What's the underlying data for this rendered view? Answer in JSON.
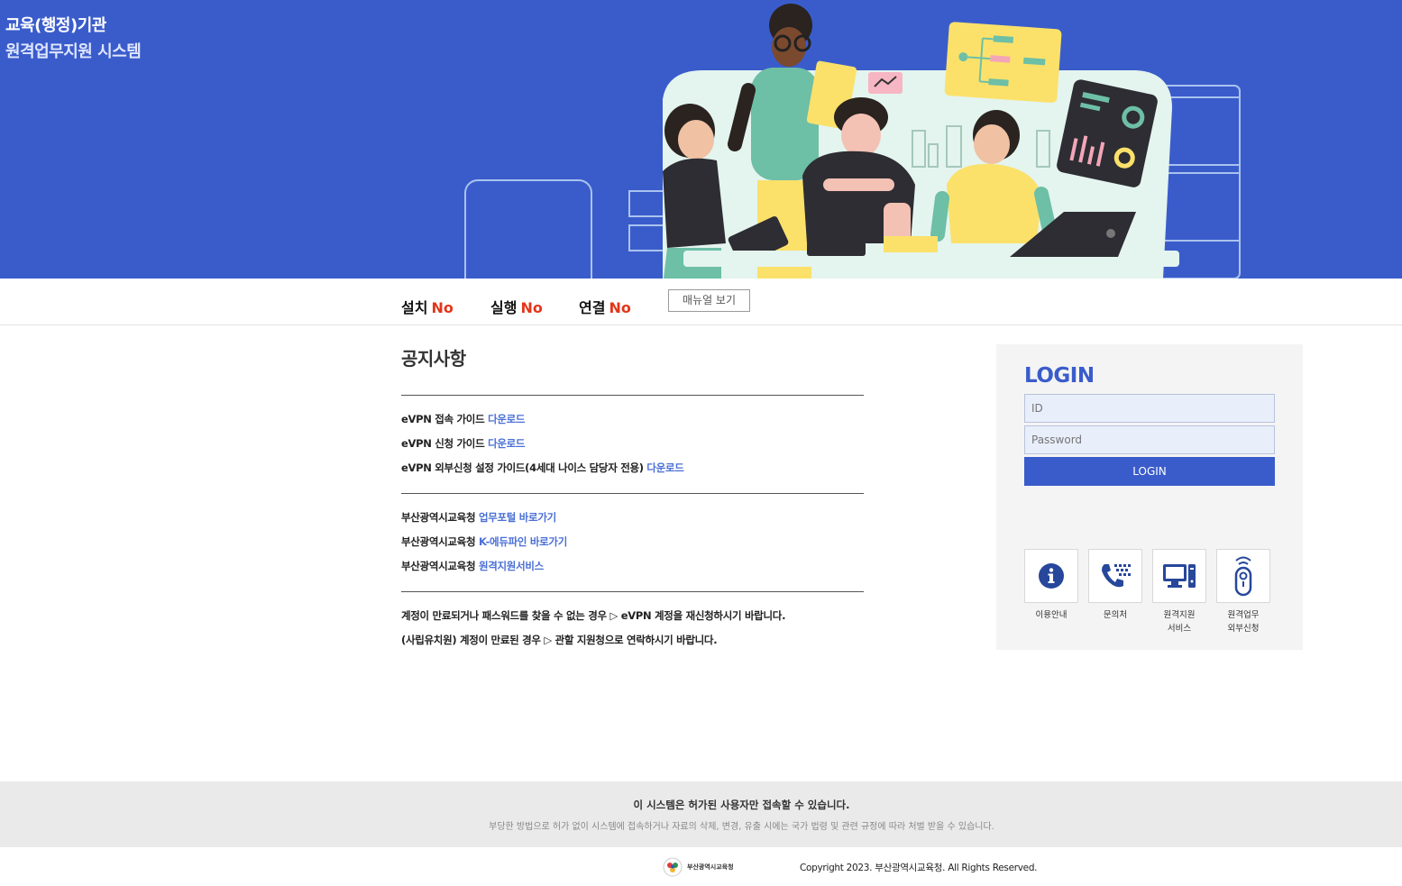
{
  "header": {
    "title_line1": "교육(행정)기관",
    "title_line2": "원격업무지원 시스템"
  },
  "status": {
    "install_label": "설치",
    "install_value": "No",
    "run_label": "실행",
    "run_value": "No",
    "connect_label": "연결",
    "connect_value": "No",
    "manual_button": "매뉴얼 보기"
  },
  "notice": {
    "title": "공지사항",
    "group1": [
      {
        "text": "eVPN 접속 가이드 ",
        "link": "다운로드"
      },
      {
        "text": "eVPN 신청 가이드 ",
        "link": "다운로드"
      },
      {
        "text": "eVPN 외부신청 설정 가이드(4세대 나이스 담당자 전용) ",
        "link": "다운로드"
      }
    ],
    "group2": [
      {
        "text": "부산광역시교육청 ",
        "link": "업무포털 바로가기"
      },
      {
        "text": "부산광역시교육청 ",
        "link": "K-에듀파인 바로가기"
      },
      {
        "text": "부산광역시교육청 ",
        "link": "원격지원서비스"
      }
    ],
    "group3": [
      "계정이 만료되거나 패스워드를 찾을 수 없는 경우 ▷ eVPN 계정을 재신청하시기 바랍니다.",
      "(사립유치원) 계정이 만료된 경우 ▷ 관할 지원청으로 연락하시기 바랍니다."
    ]
  },
  "login": {
    "title": "LOGIN",
    "id_placeholder": "ID",
    "password_placeholder": "Password",
    "button": "LOGIN",
    "quick_links": [
      {
        "label": "이용안내",
        "icon": "info-icon"
      },
      {
        "label": "문의처",
        "icon": "phone-icon"
      },
      {
        "label": "원격지원\n서비스",
        "icon": "computer-icon"
      },
      {
        "label": "원격업무\n외부신청",
        "icon": "remote-key-icon"
      }
    ]
  },
  "footer": {
    "strong": "이 시스템은 허가된 사용자만 접속할 수 있습니다.",
    "sub": "부당한 방법으로 허가 없이 시스템에 접속하거나 자료의 삭제, 변경, 유출 시에는 국가 법령 및 관련 규정에 따라 처벌 받을 수 있습니다.",
    "logo_text": "부산광역시교육청",
    "copyright": "Copyright 2023. 부산광역시교육청. All Rights Reserved."
  },
  "colors": {
    "brand_blue": "#3a5ccb",
    "status_red": "#e2361b",
    "link_blue": "#4a6fd6"
  }
}
